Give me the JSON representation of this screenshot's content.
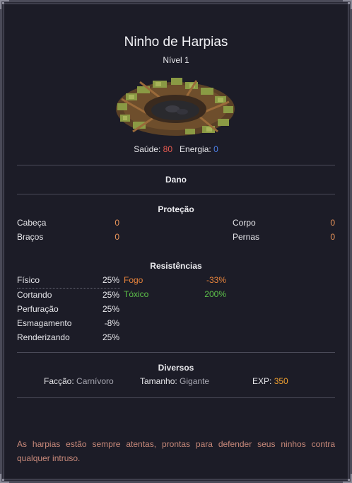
{
  "creature": {
    "name": "Ninho de Harpias",
    "level": "Nível 1",
    "image_icon": "harpy-nest-image"
  },
  "vitals": {
    "health_label": "Saúde:",
    "health_value": "80",
    "energy_label": "Energia:",
    "energy_value": "0"
  },
  "sections": {
    "damage": "Dano",
    "protection": "Proteção",
    "resistances": "Resistências",
    "misc": "Diversos"
  },
  "protection": {
    "head": {
      "label": "Cabeça",
      "value": "0"
    },
    "body": {
      "label": "Corpo",
      "value": "0"
    },
    "arms": {
      "label": "Braços",
      "value": "0"
    },
    "legs": {
      "label": "Pernas",
      "value": "0"
    }
  },
  "resistances": {
    "physical": {
      "label": "Físico",
      "value": "25%"
    },
    "cutting": {
      "label": "Cortando",
      "value": "25%"
    },
    "piercing": {
      "label": "Perfuração",
      "value": "25%"
    },
    "crushing": {
      "label": "Esmagamento",
      "value": "-8%"
    },
    "rending": {
      "label": "Renderizando",
      "value": "25%"
    },
    "fire": {
      "label": "Fogo",
      "value": "-33%"
    },
    "toxic": {
      "label": "Tóxico",
      "value": "200%"
    }
  },
  "misc": {
    "faction_label": "Facção:",
    "faction_value": "Carnívoro",
    "size_label": "Tamanho:",
    "size_value": "Gigante",
    "exp_label": "EXP:",
    "exp_value": "350"
  },
  "description": "As harpias estão sempre atentas, prontas para defender seus ninhos contra qualquer intruso.",
  "colors": {
    "background": "#1c1c27",
    "health": "#e65a50",
    "energy": "#4c7fe8",
    "exp": "#f0a030",
    "fire": "#e8843c",
    "toxic": "#5dc24a",
    "description": "#c8897a"
  }
}
